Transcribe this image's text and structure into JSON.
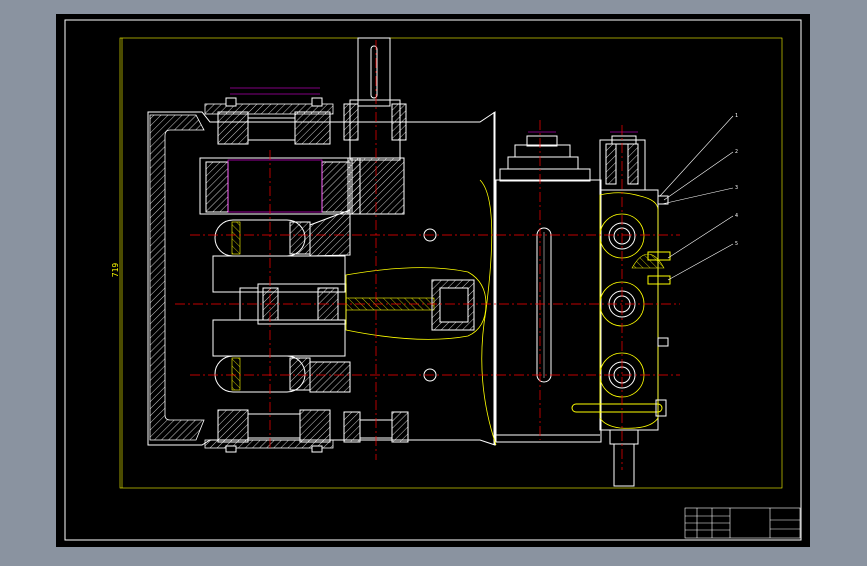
{
  "drawing": {
    "colors": {
      "background_outer": "#8a93a0",
      "sheet": "#000000",
      "frame": "#ffffff",
      "geometry": "#ffffff",
      "section_lines": "#ffff00",
      "centerline": "#ff0000",
      "hatch": "#ffffff",
      "dimension": "#ff00ff",
      "dimension_alt": "#ffff00"
    },
    "overall_dimension": "719",
    "callouts": [
      "1",
      "2",
      "3",
      "4",
      "5"
    ],
    "title_block": {
      "drawing_title": "",
      "approval_label": ""
    }
  }
}
